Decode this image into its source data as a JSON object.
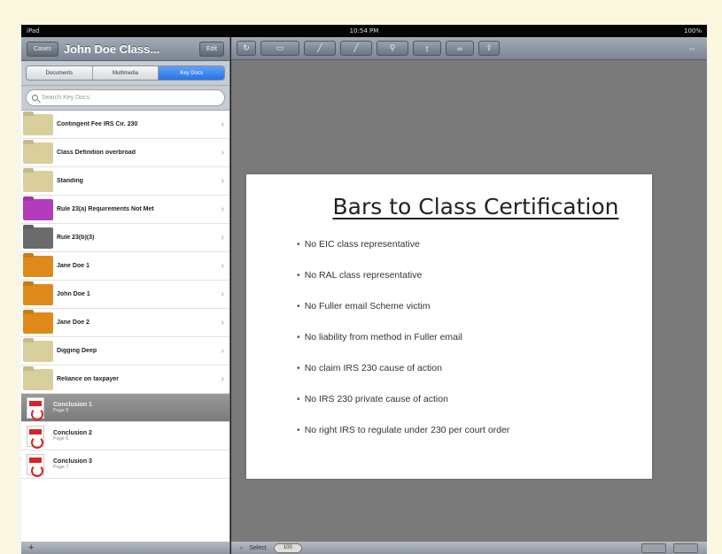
{
  "status_bar": {
    "device": "iPad",
    "time": "10:54 PM",
    "battery": "100%"
  },
  "left_panel": {
    "back_button": "Cases",
    "title": "John Doe Class...",
    "edit_button": "Edit",
    "segments": [
      "Documents",
      "Multimedia",
      "Key Docs"
    ],
    "active_segment": "Key Docs",
    "search_placeholder": "Search Key Docs",
    "folders": [
      {
        "label": "Contingent Fee IRS Cir. 230",
        "color": "#d9cf9c"
      },
      {
        "label": "Class Definition overbroad",
        "color": "#d9cf9c"
      },
      {
        "label": "Standing",
        "color": "#d9cf9c"
      },
      {
        "label": "Rule 23(a) Requirements Not Met",
        "color": "#b53bbd"
      },
      {
        "label": "Rule 23(b)(3)",
        "color": "#6b6b6b"
      },
      {
        "label": "Jane Doe 1",
        "color": "#de8a1a"
      },
      {
        "label": "John Doe 1",
        "color": "#de8a1a"
      },
      {
        "label": "Jane Doe 2",
        "color": "#de8a1a"
      },
      {
        "label": "Digging Deep",
        "color": "#d9cf9c"
      },
      {
        "label": "Reliance on taxpayer",
        "color": "#d9cf9c"
      }
    ],
    "documents": [
      {
        "title": "Conclusion 1",
        "subtitle": "Page 5",
        "selected": true
      },
      {
        "title": "Conclusion 2",
        "subtitle": "Page 6",
        "selected": false
      },
      {
        "title": "Conclusion 3",
        "subtitle": "Page 7",
        "selected": false
      }
    ],
    "add_glyph": "+"
  },
  "slide": {
    "title": "Bars to Class Certification",
    "bullets": [
      "No EIC class representative",
      "No RAL class representative",
      "No Fuller email Scheme victim",
      "No liability from method in Fuller email",
      "No claim IRS 230 cause of action",
      "No IRS 230 private cause of action",
      "No right IRS to regulate under 230 per court order"
    ]
  },
  "bottom_bar": {
    "back_glyph": "‹",
    "label": "Select",
    "pill": "100"
  }
}
